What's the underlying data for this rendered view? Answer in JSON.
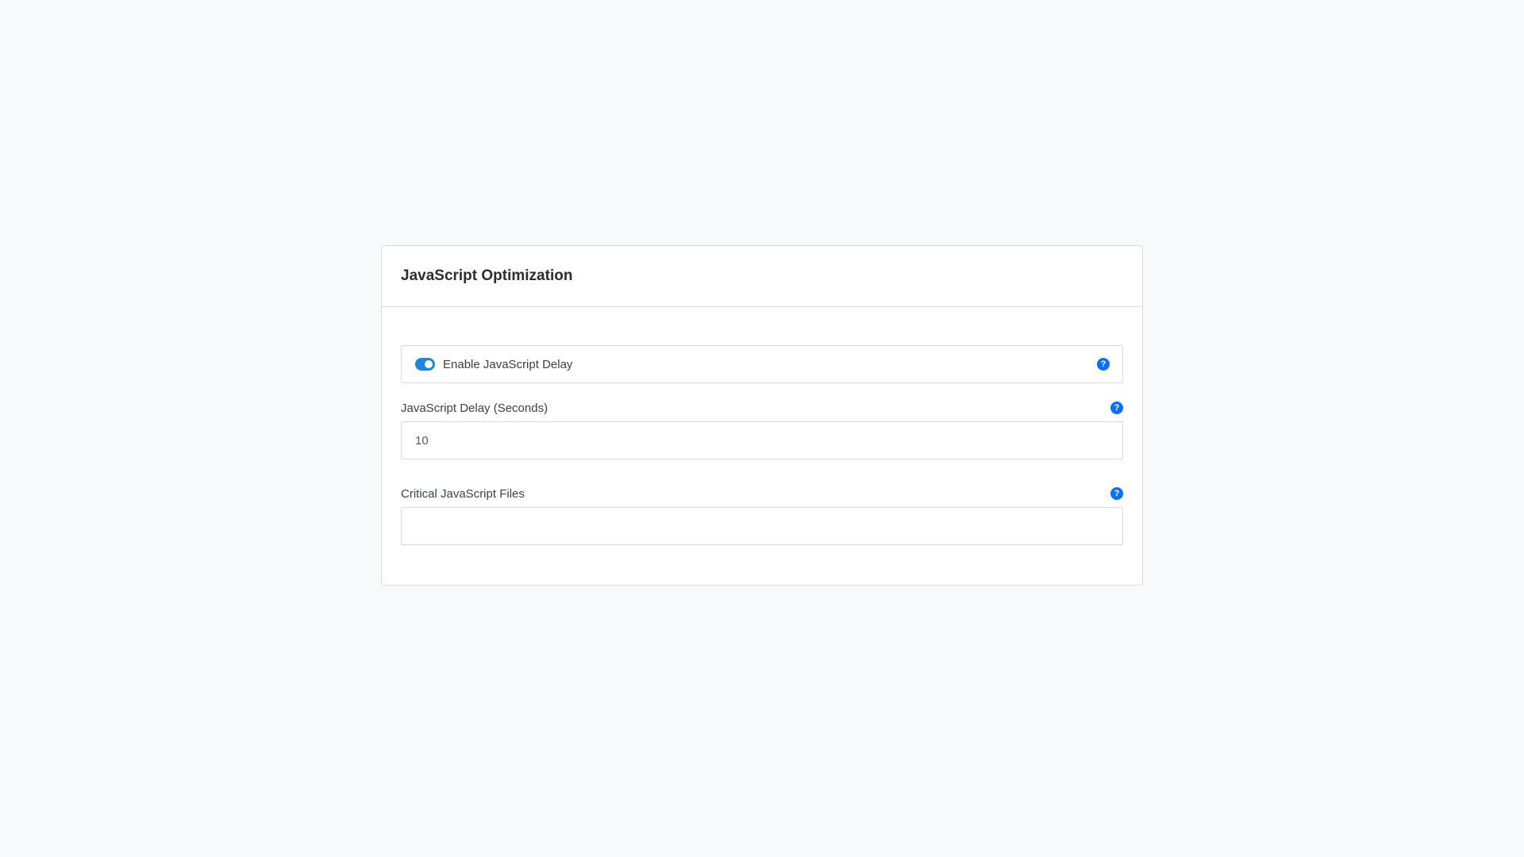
{
  "card": {
    "title": "JavaScript Optimization"
  },
  "delay_toggle": {
    "label": "Enable JavaScript Delay",
    "enabled": true,
    "help_icon": "question-circle-icon"
  },
  "delay_seconds": {
    "label": "JavaScript Delay (Seconds)",
    "value": "10",
    "help_icon": "question-circle-icon"
  },
  "critical_files": {
    "label": "Critical JavaScript Files",
    "value": "",
    "help_icon": "question-circle-icon"
  },
  "help_glyph": "?",
  "colors": {
    "accent": "#1f86df",
    "help_icon": "#0d6efd",
    "page_background": "#f8f9fa",
    "border": "#d7d9dc"
  }
}
